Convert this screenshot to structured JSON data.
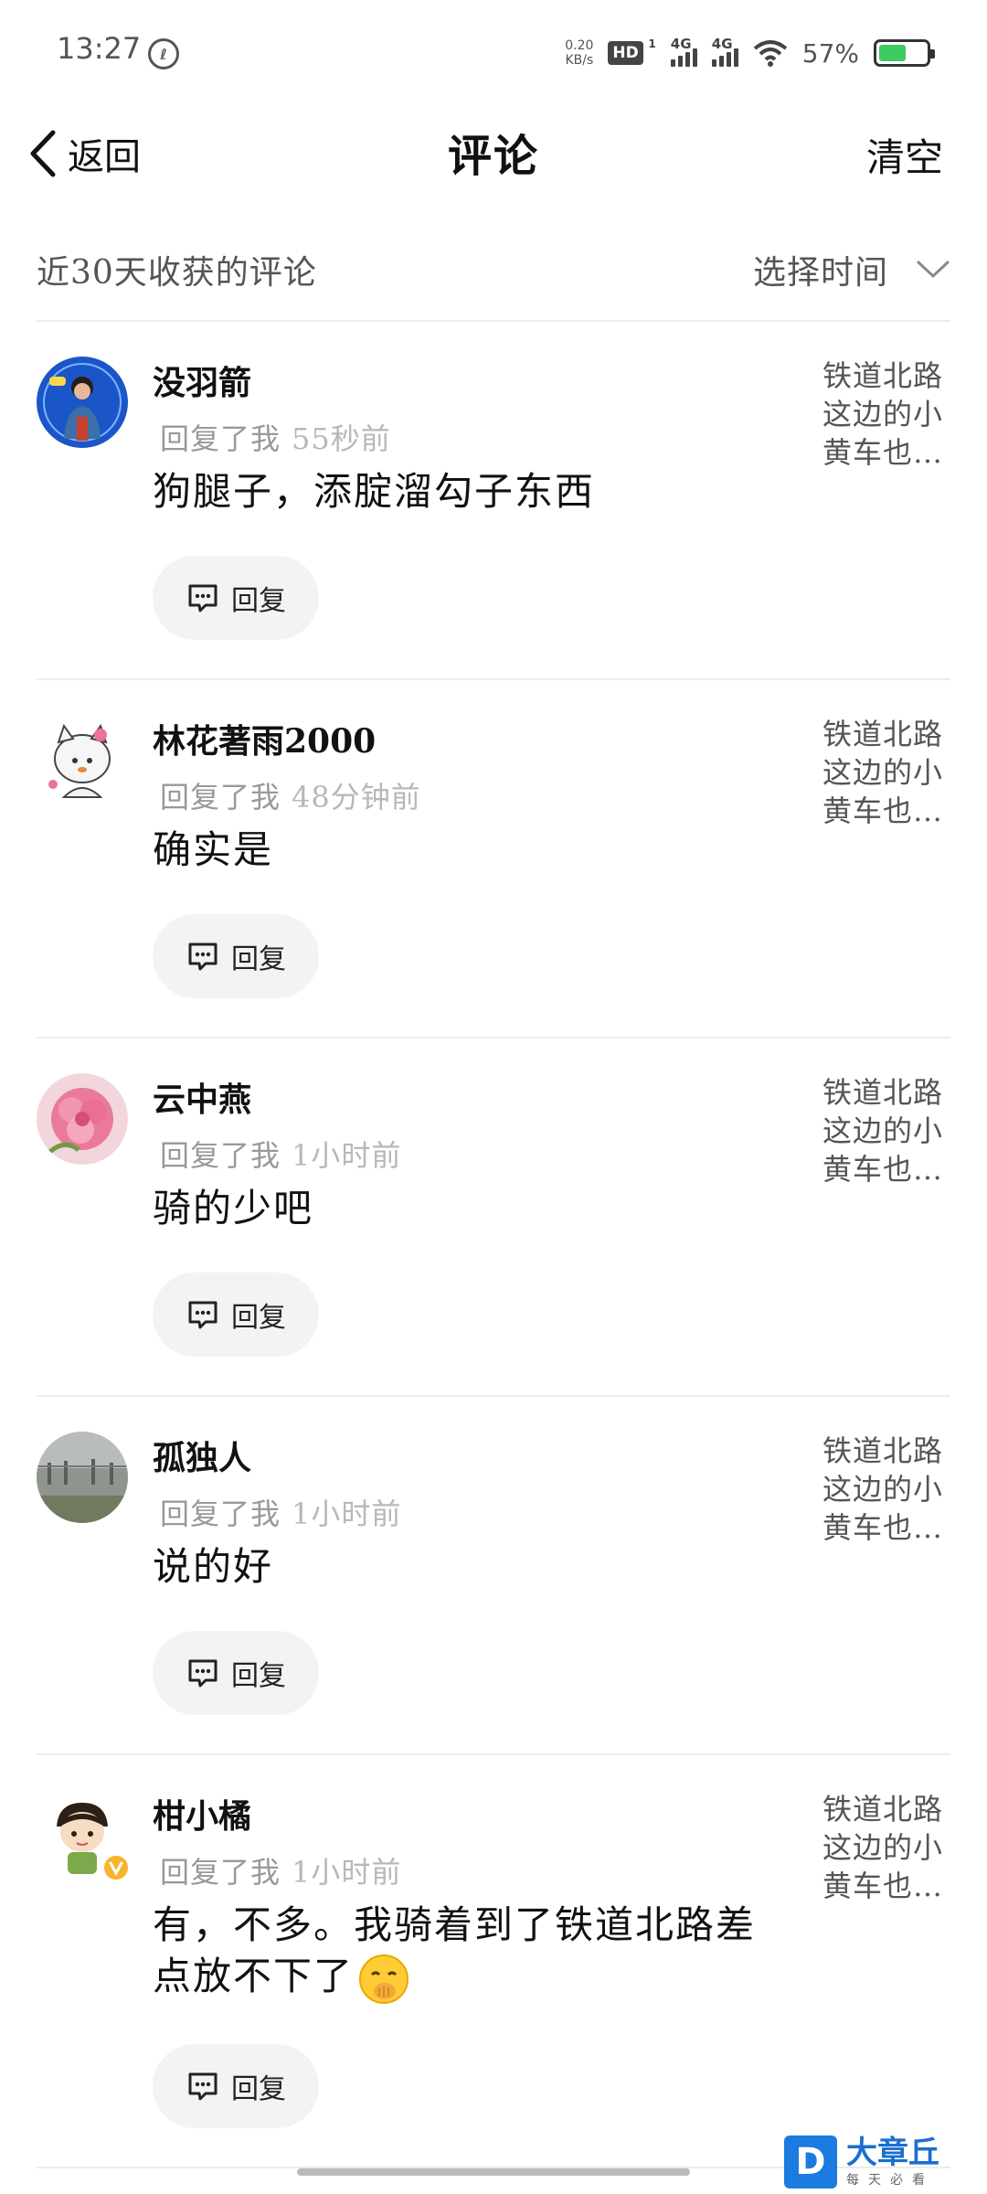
{
  "status_bar": {
    "time": "13:27",
    "net_speed_value": "0.20",
    "net_speed_unit": "KB/s",
    "hd_label": "HD",
    "hd_sub": "1",
    "signal1_label": "4G",
    "signal2_label": "4G",
    "battery_percent": "57%",
    "battery_level": 0.57,
    "battery_color": "#3ecb63"
  },
  "header": {
    "back_label": "返回",
    "title": "评论",
    "clear_label": "清空"
  },
  "filter": {
    "label": "近30天收获的评论",
    "select_label": "选择时间"
  },
  "comments": [
    {
      "username": "没羽箭",
      "meta_prefix": "回复了我",
      "time": "55秒前",
      "text": "狗腿子，添腚溜勾子东西",
      "reply_label": "回复",
      "ref_text": "铁道北路这边的小黄车也…"
    },
    {
      "username": "林花著雨2000",
      "meta_prefix": "回复了我",
      "time": "48分钟前",
      "text": "确实是",
      "reply_label": "回复",
      "ref_text": "铁道北路这边的小黄车也…"
    },
    {
      "username": "云中燕",
      "meta_prefix": "回复了我",
      "time": "1小时前",
      "text": "骑的少吧",
      "reply_label": "回复",
      "ref_text": "铁道北路这边的小黄车也…"
    },
    {
      "username": "孤独人",
      "meta_prefix": "回复了我",
      "time": "1小时前",
      "text": "说的好",
      "reply_label": "回复",
      "ref_text": "铁道北路这边的小黄车也…"
    },
    {
      "username": "柑小橘",
      "meta_prefix": "回复了我",
      "time": "1小时前",
      "text": "有，不多。我骑着到了铁道北路差点放不下了",
      "reply_label": "回复",
      "ref_text": "铁道北路这边的小黄车也…"
    }
  ],
  "watermark": {
    "logo_letter": "D",
    "title": "大章丘",
    "subtitle": "每天必看"
  }
}
